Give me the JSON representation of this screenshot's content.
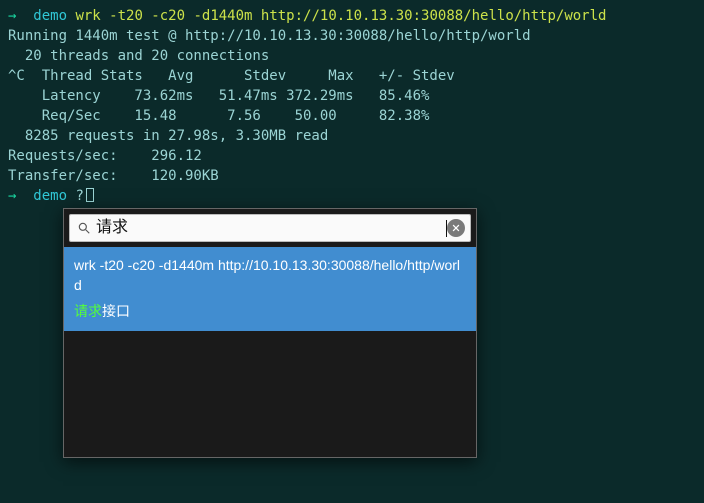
{
  "terminal": {
    "line1": {
      "arrow": "→",
      "dir": "demo",
      "cmd": "wrk -t20 -c20 -d1440m http://10.10.13.30:30088/hello/http/world"
    },
    "line2": "Running 1440m test @ http://10.10.13.30:30088/hello/http/world",
    "line3": "  20 threads and 20 connections",
    "line4": "^C  Thread Stats   Avg      Stdev     Max   +/- Stdev",
    "line5": "    Latency    73.62ms   51.47ms 372.29ms   85.46%",
    "line6": "    Req/Sec    15.48      7.56    50.00     82.38%",
    "line7": "  8285 requests in 27.98s, 3.30MB read",
    "line8": "Requests/sec:    296.12",
    "line9": "Transfer/sec:    120.90KB",
    "line10": {
      "arrow": "→",
      "dir": "demo",
      "q": "?"
    }
  },
  "popup": {
    "search_value": "请求",
    "clear_title": "Clear",
    "result": {
      "command": "wrk -t20 -c20 -d1440m http://10.10.13.30:30088/hello/http/world",
      "match": "请求",
      "rest": "接口"
    }
  }
}
